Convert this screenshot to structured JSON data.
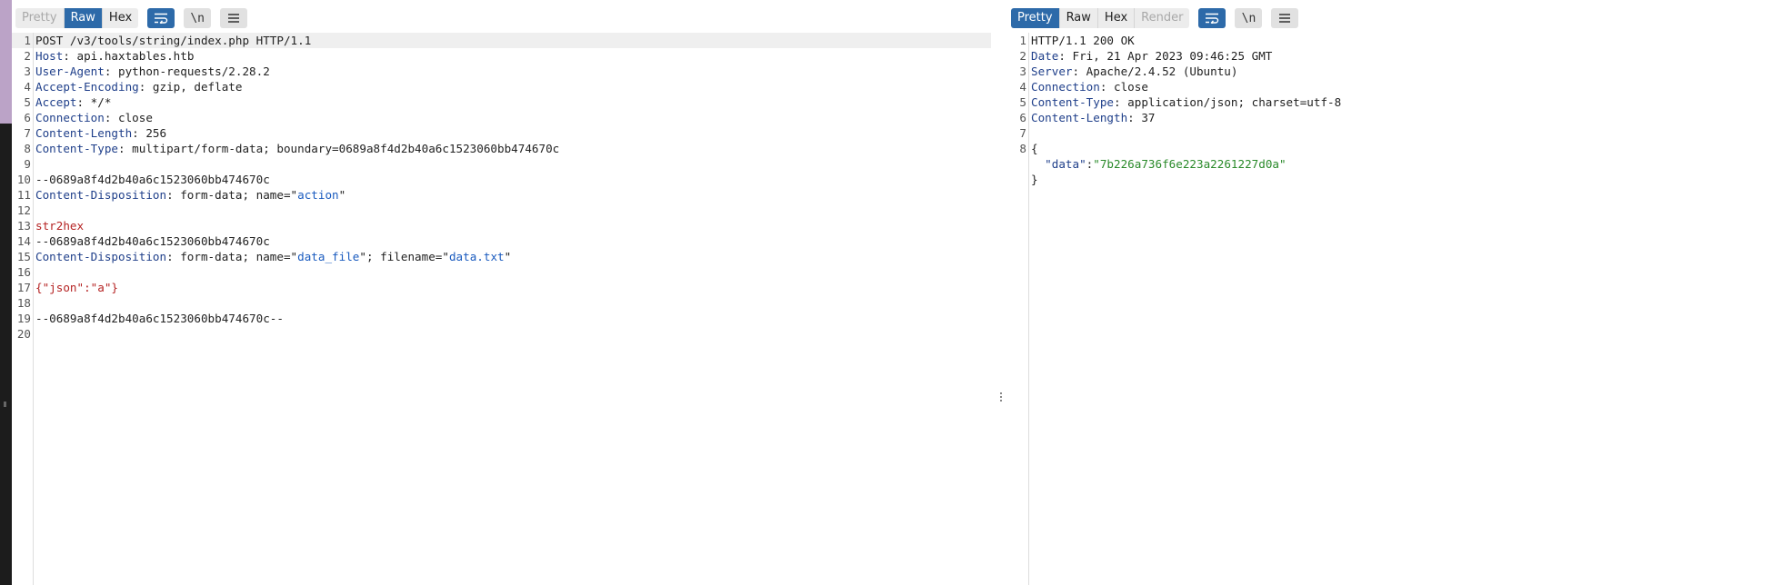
{
  "request": {
    "tabs": [
      {
        "label": "Pretty",
        "state": "disabled"
      },
      {
        "label": "Raw",
        "state": "active"
      },
      {
        "label": "Hex",
        "state": "normal"
      }
    ],
    "newline_label": "\\n",
    "lines": [
      {
        "n": "1",
        "parts": [
          {
            "t": "POST /v3/tools/string/index.php HTTP/1.1",
            "c": ""
          }
        ]
      },
      {
        "n": "2",
        "parts": [
          {
            "t": "Host",
            "c": "k"
          },
          {
            "t": ": api.haxtables.htb",
            "c": ""
          }
        ]
      },
      {
        "n": "3",
        "parts": [
          {
            "t": "User-Agent",
            "c": "k"
          },
          {
            "t": ": python-requests/2.28.2",
            "c": ""
          }
        ]
      },
      {
        "n": "4",
        "parts": [
          {
            "t": "Accept-Encoding",
            "c": "k"
          },
          {
            "t": ": gzip, deflate",
            "c": ""
          }
        ]
      },
      {
        "n": "5",
        "parts": [
          {
            "t": "Accept",
            "c": "k"
          },
          {
            "t": ": */*",
            "c": ""
          }
        ]
      },
      {
        "n": "6",
        "parts": [
          {
            "t": "Connection",
            "c": "k"
          },
          {
            "t": ": close",
            "c": ""
          }
        ]
      },
      {
        "n": "7",
        "parts": [
          {
            "t": "Content-Length",
            "c": "k"
          },
          {
            "t": ": 256",
            "c": ""
          }
        ]
      },
      {
        "n": "8",
        "parts": [
          {
            "t": "Content-Type",
            "c": "k"
          },
          {
            "t": ": multipart/form-data; boundary=0689a8f4d2b40a6c1523060bb474670c",
            "c": ""
          }
        ]
      },
      {
        "n": "9",
        "parts": []
      },
      {
        "n": "10",
        "parts": [
          {
            "t": "--0689a8f4d2b40a6c1523060bb474670c",
            "c": ""
          }
        ]
      },
      {
        "n": "11",
        "parts": [
          {
            "t": "Content-Disposition",
            "c": "k"
          },
          {
            "t": ": form-data; name=\"",
            "c": ""
          },
          {
            "t": "action",
            "c": "s"
          },
          {
            "t": "\"",
            "c": ""
          }
        ]
      },
      {
        "n": "12",
        "parts": []
      },
      {
        "n": "13",
        "parts": [
          {
            "t": "str2hex",
            "c": "body-red"
          }
        ]
      },
      {
        "n": "14",
        "parts": [
          {
            "t": "--0689a8f4d2b40a6c1523060bb474670c",
            "c": ""
          }
        ]
      },
      {
        "n": "15",
        "parts": [
          {
            "t": "Content-Disposition",
            "c": "k"
          },
          {
            "t": ": form-data; name=\"",
            "c": ""
          },
          {
            "t": "data_file",
            "c": "s"
          },
          {
            "t": "\"; filename=\"",
            "c": ""
          },
          {
            "t": "data.txt",
            "c": "s"
          },
          {
            "t": "\"",
            "c": ""
          }
        ]
      },
      {
        "n": "16",
        "parts": []
      },
      {
        "n": "17",
        "parts": [
          {
            "t": "{\"json\":\"a\"}",
            "c": "body-red"
          }
        ]
      },
      {
        "n": "18",
        "parts": []
      },
      {
        "n": "19",
        "parts": [
          {
            "t": "--0689a8f4d2b40a6c1523060bb474670c--",
            "c": ""
          }
        ]
      },
      {
        "n": "20",
        "parts": []
      }
    ]
  },
  "response": {
    "tabs": [
      {
        "label": "Pretty",
        "state": "active"
      },
      {
        "label": "Raw",
        "state": "normal"
      },
      {
        "label": "Hex",
        "state": "normal"
      },
      {
        "label": "Render",
        "state": "disabled"
      }
    ],
    "newline_label": "\\n",
    "lines": [
      {
        "n": "1",
        "parts": [
          {
            "t": "HTTP/1.1 200 OK",
            "c": ""
          }
        ]
      },
      {
        "n": "2",
        "parts": [
          {
            "t": "Date",
            "c": "k"
          },
          {
            "t": ": Fri, 21 Apr 2023 09:46:25 GMT",
            "c": ""
          }
        ]
      },
      {
        "n": "3",
        "parts": [
          {
            "t": "Server",
            "c": "k"
          },
          {
            "t": ": Apache/2.4.52 (Ubuntu)",
            "c": ""
          }
        ]
      },
      {
        "n": "4",
        "parts": [
          {
            "t": "Connection",
            "c": "k"
          },
          {
            "t": ": close",
            "c": ""
          }
        ]
      },
      {
        "n": "5",
        "parts": [
          {
            "t": "Content-Type",
            "c": "k"
          },
          {
            "t": ": application/json; charset=utf-8",
            "c": ""
          }
        ]
      },
      {
        "n": "6",
        "parts": [
          {
            "t": "Content-Length",
            "c": "k"
          },
          {
            "t": ": 37",
            "c": ""
          }
        ]
      },
      {
        "n": "7",
        "parts": []
      },
      {
        "n": "8",
        "parts": [
          {
            "t": "{",
            "c": ""
          }
        ]
      },
      {
        "n": "",
        "parts": [
          {
            "t": "  ",
            "c": ""
          },
          {
            "t": "\"data\"",
            "c": "k"
          },
          {
            "t": ":",
            "c": ""
          },
          {
            "t": "\"7b226a736f6e223a2261227d0a\"",
            "c": "str-green"
          }
        ]
      },
      {
        "n": "",
        "parts": [
          {
            "t": "}",
            "c": ""
          }
        ]
      }
    ]
  }
}
